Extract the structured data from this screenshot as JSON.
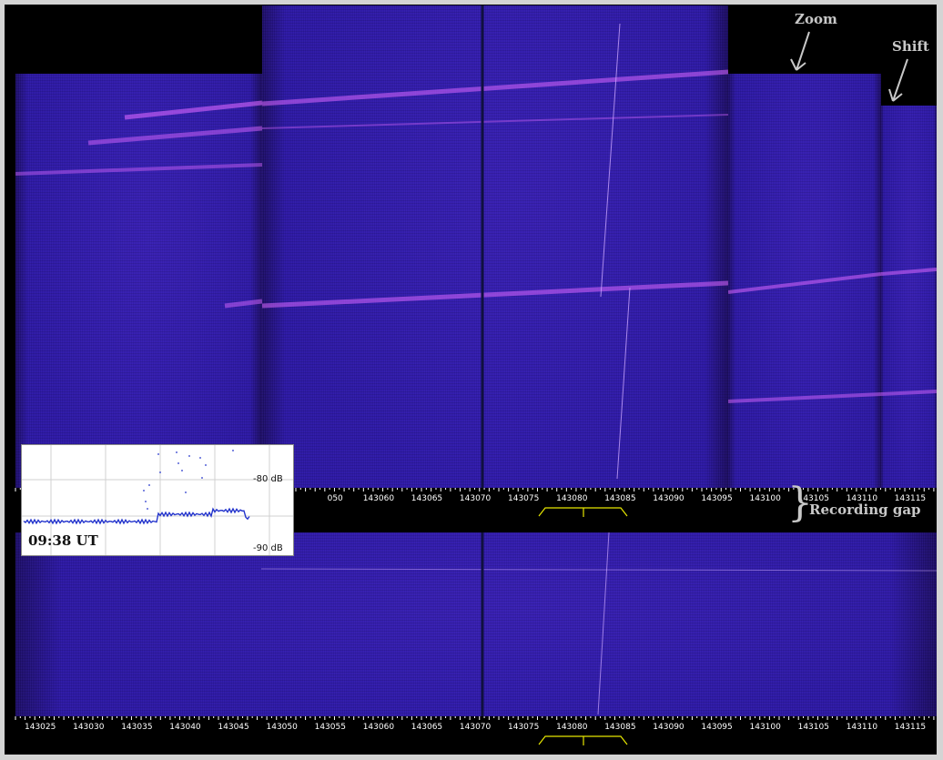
{
  "ticks": [
    "143025",
    "143030",
    "143035",
    "143040",
    "143045",
    "143050",
    "143055",
    "143060",
    "143065",
    "143070",
    "143075",
    "143080",
    "143085",
    "143090",
    "143095",
    "143100",
    "143105",
    "143110",
    "143115"
  ],
  "upper_axis_first_visible_label": "050",
  "annotations": {
    "zoom": "Zoom",
    "shift": "Shift",
    "gap_brace": "}",
    "recording_gap": "Recording gap"
  },
  "inset": {
    "time": "09:38 UT",
    "db_top": "-80 dB",
    "db_bottom": "-90 dB"
  },
  "colors": {
    "waterfall_bg": "#2e1aa6",
    "trail": "#d866ff",
    "passband": "#e6e600",
    "inset_trace": "#2233cc"
  }
}
